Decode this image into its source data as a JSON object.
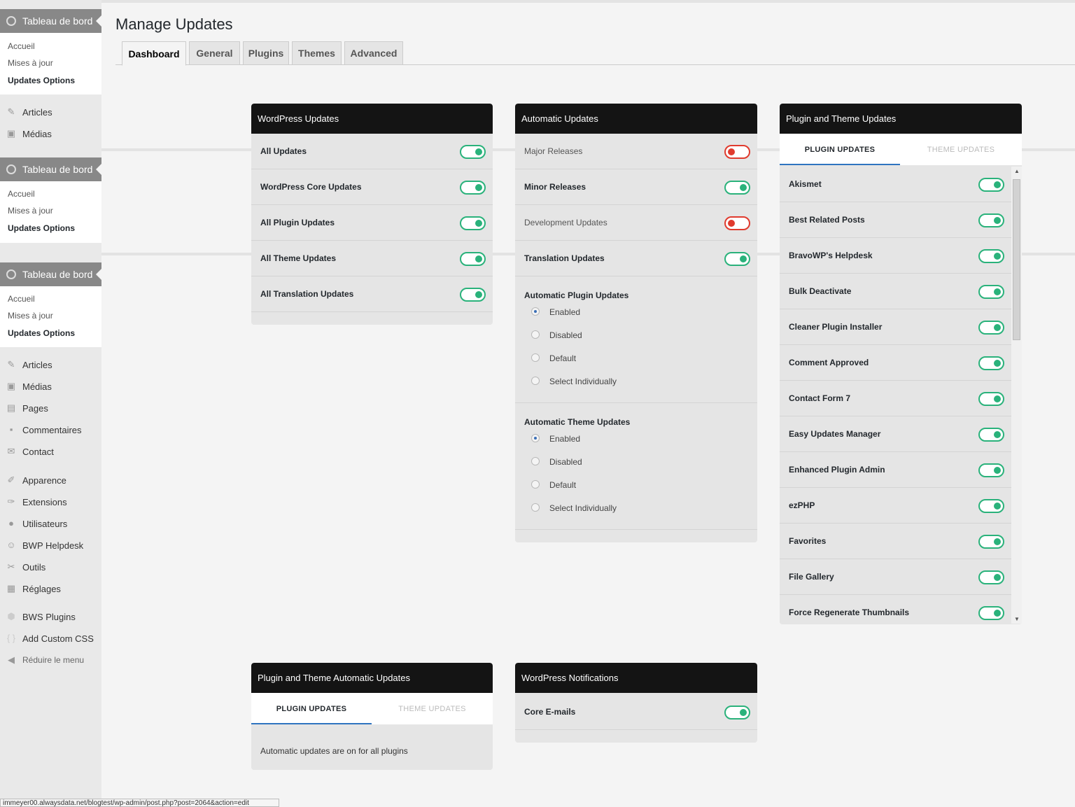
{
  "sidebar": {
    "dashboard_label": "Tableau de bord",
    "sub_items": [
      "Accueil",
      "Mises à jour",
      "Updates Options"
    ],
    "menu": {
      "articles": "Articles",
      "medias": "Médias",
      "pages": "Pages",
      "commentaires": "Commentaires",
      "contact": "Contact",
      "apparence": "Apparence",
      "extensions": "Extensions",
      "utilisateurs": "Utilisateurs",
      "bwp_helpdesk": "BWP Helpdesk",
      "outils": "Outils",
      "reglages": "Réglages",
      "bws_plugins": "BWS Plugins",
      "add_custom_css": "Add Custom CSS",
      "reduire": "Réduire le menu"
    }
  },
  "page": {
    "title": "Manage Updates",
    "tabs": [
      "Dashboard",
      "General",
      "Plugins",
      "Themes",
      "Advanced"
    ],
    "active_tab": "Dashboard"
  },
  "wordpress_updates": {
    "title": "WordPress Updates",
    "rows": [
      {
        "label": "All Updates",
        "on": true
      },
      {
        "label": "WordPress Core Updates",
        "on": true
      },
      {
        "label": "All Plugin Updates",
        "on": true
      },
      {
        "label": "All Theme Updates",
        "on": true
      },
      {
        "label": "All Translation Updates",
        "on": true
      }
    ]
  },
  "automatic_updates": {
    "title": "Automatic Updates",
    "rows": [
      {
        "label": "Major Releases",
        "on": false
      },
      {
        "label": "Minor Releases",
        "on": true
      },
      {
        "label": "Development Updates",
        "on": false
      },
      {
        "label": "Translation Updates",
        "on": true
      }
    ],
    "plugin_group": {
      "title": "Automatic Plugin Updates",
      "options": [
        "Enabled",
        "Disabled",
        "Default",
        "Select Individually"
      ],
      "selected": "Enabled"
    },
    "theme_group": {
      "title": "Automatic Theme Updates",
      "options": [
        "Enabled",
        "Disabled",
        "Default",
        "Select Individually"
      ],
      "selected": "Enabled"
    }
  },
  "plugin_theme_updates": {
    "title": "Plugin and Theme Updates",
    "tabs": [
      "PLUGIN UPDATES",
      "THEME UPDATES"
    ],
    "plugins": [
      {
        "label": "Akismet",
        "on": true
      },
      {
        "label": "Best Related Posts",
        "on": true
      },
      {
        "label": "BravoWP's Helpdesk",
        "on": true
      },
      {
        "label": "Bulk Deactivate",
        "on": true
      },
      {
        "label": "Cleaner Plugin Installer",
        "on": true
      },
      {
        "label": "Comment Approved",
        "on": true
      },
      {
        "label": "Contact Form 7",
        "on": true
      },
      {
        "label": "Easy Updates Manager",
        "on": true
      },
      {
        "label": "Enhanced Plugin Admin",
        "on": true
      },
      {
        "label": "ezPHP",
        "on": true
      },
      {
        "label": "Favorites",
        "on": true
      },
      {
        "label": "File Gallery",
        "on": true
      },
      {
        "label": "Force Regenerate Thumbnails",
        "on": true
      }
    ]
  },
  "plugin_theme_automatic": {
    "title": "Plugin and Theme Automatic Updates",
    "tabs": [
      "PLUGIN UPDATES",
      "THEME UPDATES"
    ],
    "message": "Automatic updates are on for all plugins"
  },
  "notifications": {
    "title": "WordPress Notifications",
    "rows": [
      {
        "label": "Core E-mails",
        "on": true
      }
    ]
  },
  "status_bar": "immeyer00.alwaysdata.net/blogtest/wp-admin/post.php?post=2064&action=edit",
  "colors": {
    "accent_on": "#2ab27b",
    "accent_off": "#e03b2e",
    "header_bg": "#141414",
    "tab_underline": "#2f74c0"
  }
}
